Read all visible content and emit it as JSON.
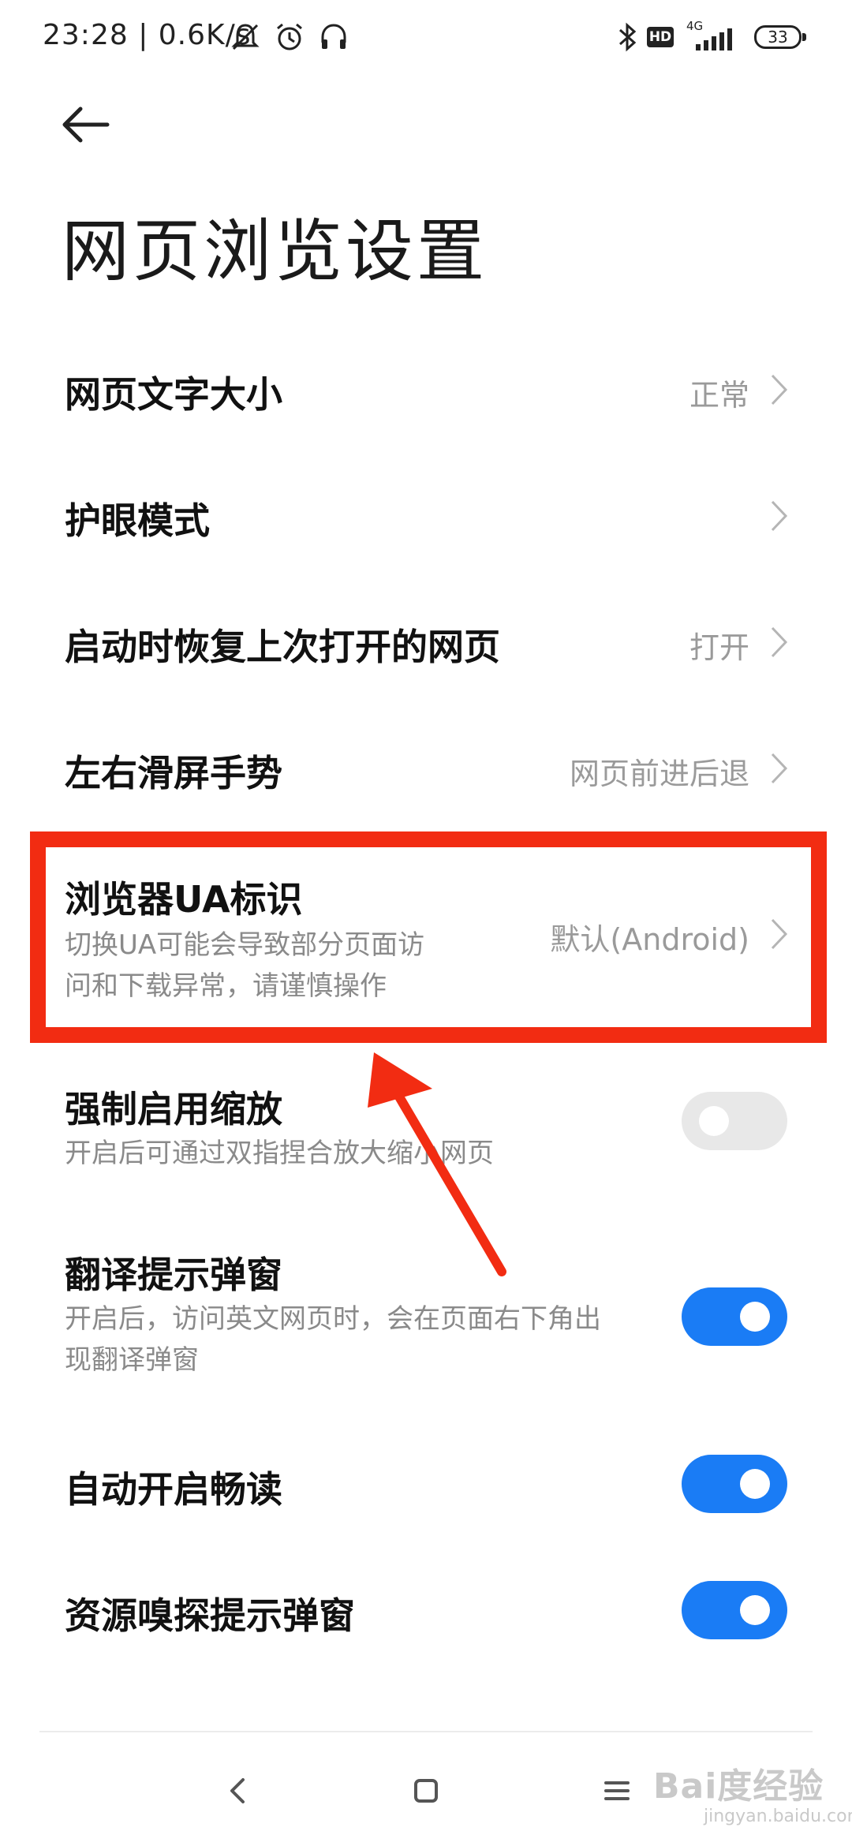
{
  "status_bar": {
    "time_speed": "23:28 | 0.6K/s",
    "network": "4G",
    "hd_badge": "HD",
    "battery": "33"
  },
  "header": {
    "back_icon": "back-arrow-icon",
    "title": "网页浏览设置"
  },
  "settings": [
    {
      "label": "网页文字大小",
      "value": "正常"
    },
    {
      "label": "护眼模式",
      "value": ""
    },
    {
      "label": "启动时恢复上次打开的网页",
      "value": "打开"
    },
    {
      "label": "左右滑屏手势",
      "value": "网页前进后退"
    },
    {
      "label": "浏览器UA标识",
      "sub_line1": "切换UA可能会导致部分页面访",
      "sub_line2": "问和下载异常，请谨慎操作",
      "value": "默认(Android)"
    }
  ],
  "toggles": [
    {
      "label": "强制启用缩放",
      "sub_line1": "开启后可通过双指捏合放大缩小网页",
      "sub_line2": "",
      "on": false
    },
    {
      "label": "翻译提示弹窗",
      "sub_line1": "开启后，访问英文网页时，会在页面右下角出",
      "sub_line2": "现翻译弹窗",
      "on": true
    },
    {
      "label": "自动开启畅读",
      "sub_line1": "",
      "sub_line2": "",
      "on": true
    },
    {
      "label": "资源嗅探提示弹窗",
      "sub_line1": "",
      "sub_line2": "",
      "on": true
    }
  ],
  "colors": {
    "toggle_on": "#1a7cf5",
    "toggle_off": "#e8e8e8",
    "annotation_red": "#f22c12"
  },
  "nav": {
    "back": "nav-back-icon",
    "home": "nav-home-icon",
    "menu": "nav-menu-icon"
  },
  "watermark": {
    "brand": "Bai度经验",
    "url": "jingyan.baidu.com"
  }
}
